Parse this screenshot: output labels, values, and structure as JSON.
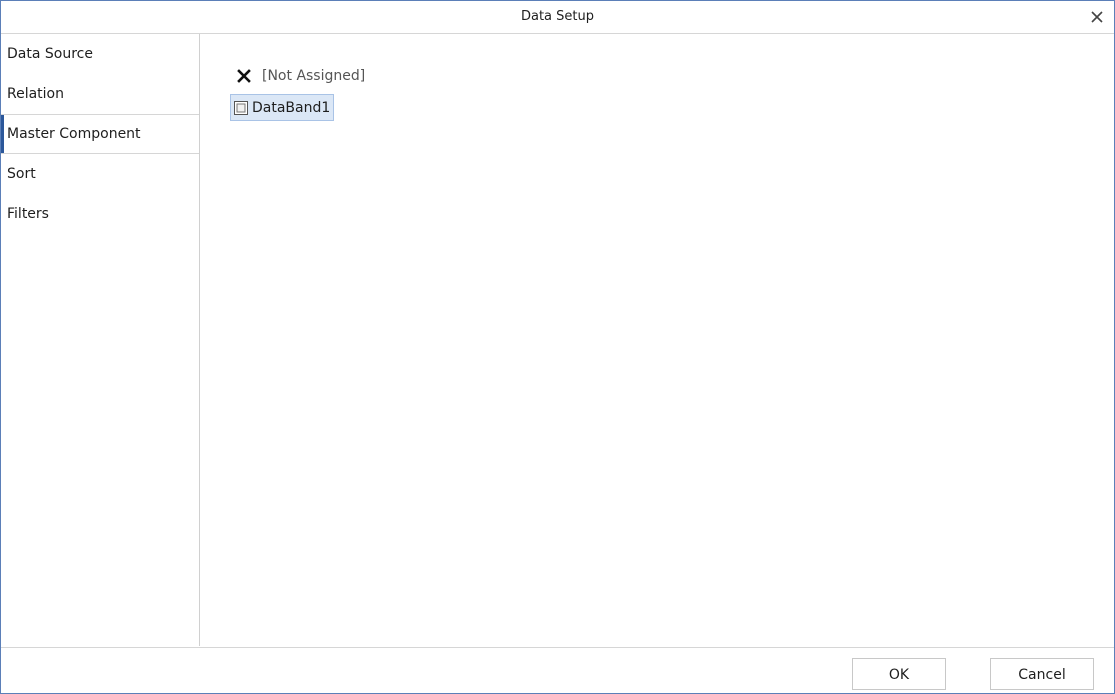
{
  "window": {
    "title": "Data Setup",
    "close_icon": "close-icon"
  },
  "sidebar": {
    "items": [
      {
        "label": "Data Source"
      },
      {
        "label": "Relation"
      },
      {
        "label": "Master Component",
        "selected": true
      },
      {
        "label": "Sort"
      },
      {
        "label": "Filters"
      }
    ]
  },
  "main": {
    "items": [
      {
        "label": "[Not Assigned]",
        "icon": "x-icon"
      },
      {
        "label": "DataBand1",
        "icon": "databand-icon",
        "selected": true
      }
    ]
  },
  "footer": {
    "ok_label": "OK",
    "cancel_label": "Cancel"
  },
  "colors": {
    "accent": "#2b579a",
    "selection_bg": "#dbe7f6",
    "window_border": "#5b7fb8"
  }
}
